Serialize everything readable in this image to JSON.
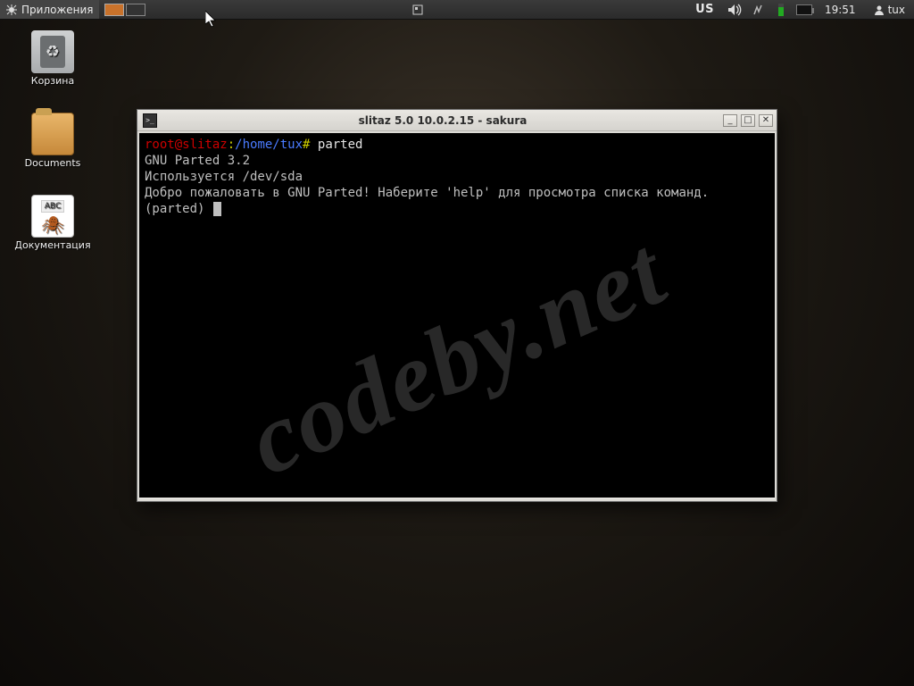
{
  "panel": {
    "menu_label": "Приложения",
    "keyboard_layout": "US",
    "clock": "19:51",
    "username": "tux"
  },
  "desktop_icons": {
    "trash": "Корзина",
    "documents": "Documents",
    "documentation": "Документация"
  },
  "window": {
    "title": "slitaz 5.0 10.0.2.15  -  sakura"
  },
  "terminal": {
    "prompt_user": "root@slitaz",
    "prompt_sep": ":",
    "prompt_path": "/home/tux",
    "prompt_hash": "#",
    "command": "parted",
    "line2": "GNU Parted 3.2",
    "line3": "Используется /dev/sda",
    "line4": "Добро пожаловать в GNU Parted! Наберите 'help' для просмотра списка команд.",
    "line5_prefix": "(parted) "
  },
  "watermark": "codeby.net"
}
